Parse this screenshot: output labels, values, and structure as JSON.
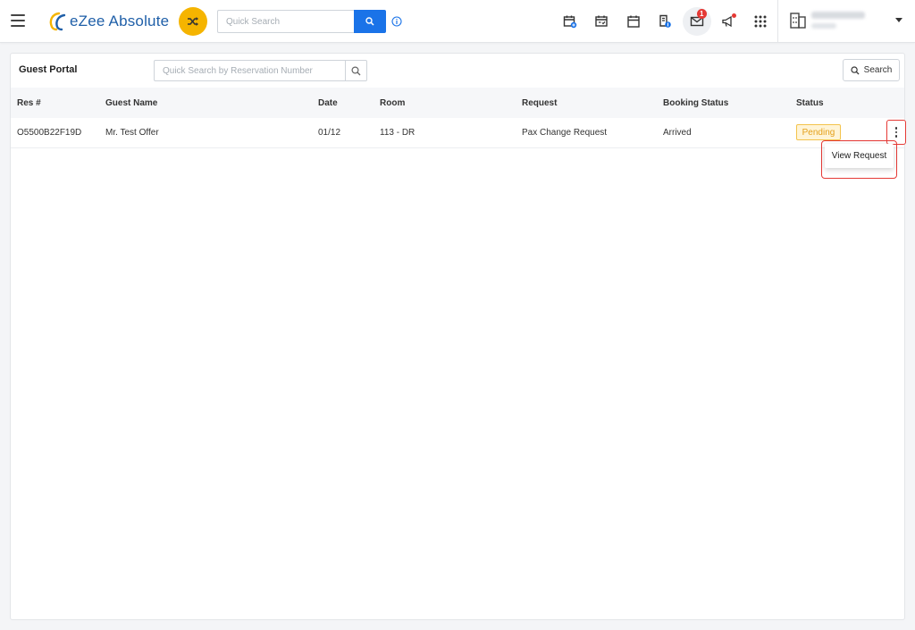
{
  "header": {
    "app_name": "eZee Absolute",
    "quick_search_placeholder": "Quick Search",
    "notifications_badge": "1",
    "accent_color": "#1a73e8",
    "shuffle_color": "#f5b400",
    "icons": [
      "calendar-add-icon",
      "calendar-check-icon",
      "calendar-icon",
      "billing-icon",
      "mail-icon",
      "megaphone-icon",
      "apps-grid-icon"
    ]
  },
  "guest_portal": {
    "title": "Guest Portal",
    "search_placeholder": "Quick Search by Reservation Number",
    "search_button_label": "Search",
    "columns": [
      "Res #",
      "Guest Name",
      "Date",
      "Room",
      "Request",
      "Booking Status",
      "Status"
    ],
    "rows": [
      {
        "res_no": "O5500B22F19D",
        "guest_name": "Mr. Test Offer",
        "date": "01/12",
        "room": "113 - DR",
        "request": "Pax Change Request",
        "booking_status": "Arrived",
        "status": "Pending"
      }
    ],
    "row_menu": {
      "items": [
        "View Request"
      ]
    }
  }
}
